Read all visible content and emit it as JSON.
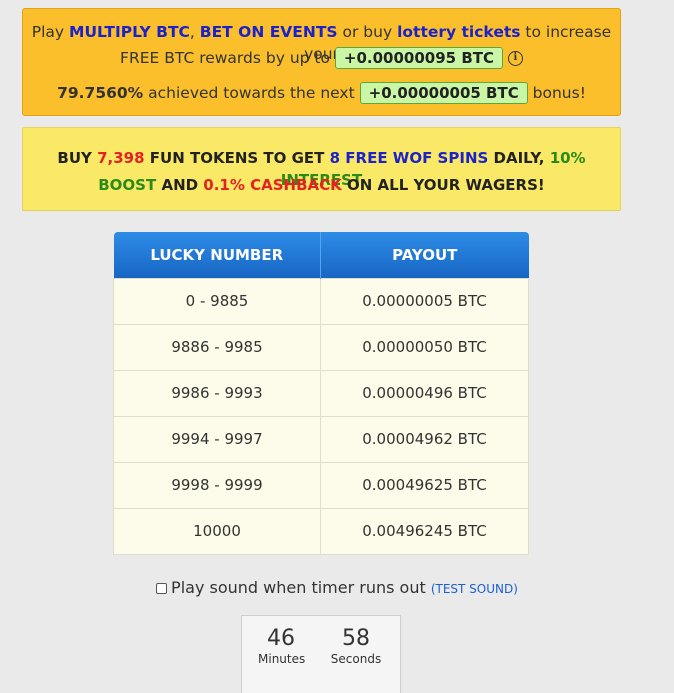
{
  "promo": {
    "line1_pre": "Play ",
    "multiply": "MULTIPLY BTC",
    "comma": ", ",
    "bet": "BET ON EVENTS",
    "or_buy": " or buy ",
    "lottery": "lottery tickets",
    "line1_post": " to increase your",
    "line2_pre": "FREE BTC rewards by up to ",
    "reward_amount": "+0.00000095 BTC",
    "info_glyph": "i",
    "progress_pct": "79.7560%",
    "progress_text": " achieved towards the next ",
    "bonus_amount": "+0.00000005 BTC",
    "bonus_suffix": " bonus!"
  },
  "fun_tokens": {
    "buy": "BUY ",
    "count": "7,398",
    "get": " FUN TOKENS TO GET ",
    "spins": "8 FREE WOF SPINS",
    "daily": " DAILY, ",
    "interest": "10% INTEREST",
    "boost": "BOOST",
    "and": " AND ",
    "cashback": "0.1% CASHBACK",
    "wagers": " ON ALL YOUR WAGERS!"
  },
  "table": {
    "headers": [
      "LUCKY NUMBER",
      "PAYOUT"
    ],
    "rows": [
      [
        "0 - 9885",
        "0.00000005 BTC"
      ],
      [
        "9886 - 9985",
        "0.00000050 BTC"
      ],
      [
        "9986 - 9993",
        "0.00000496 BTC"
      ],
      [
        "9994 - 9997",
        "0.00004962 BTC"
      ],
      [
        "9998 - 9999",
        "0.00049625 BTC"
      ],
      [
        "10000",
        "0.00496245 BTC"
      ]
    ]
  },
  "sound": {
    "label": "Play sound when timer runs out ",
    "test_link": "(TEST SOUND)"
  },
  "timer": {
    "minutes": "46",
    "minutes_label": "Minutes",
    "seconds": "58",
    "seconds_label": "Seconds"
  }
}
